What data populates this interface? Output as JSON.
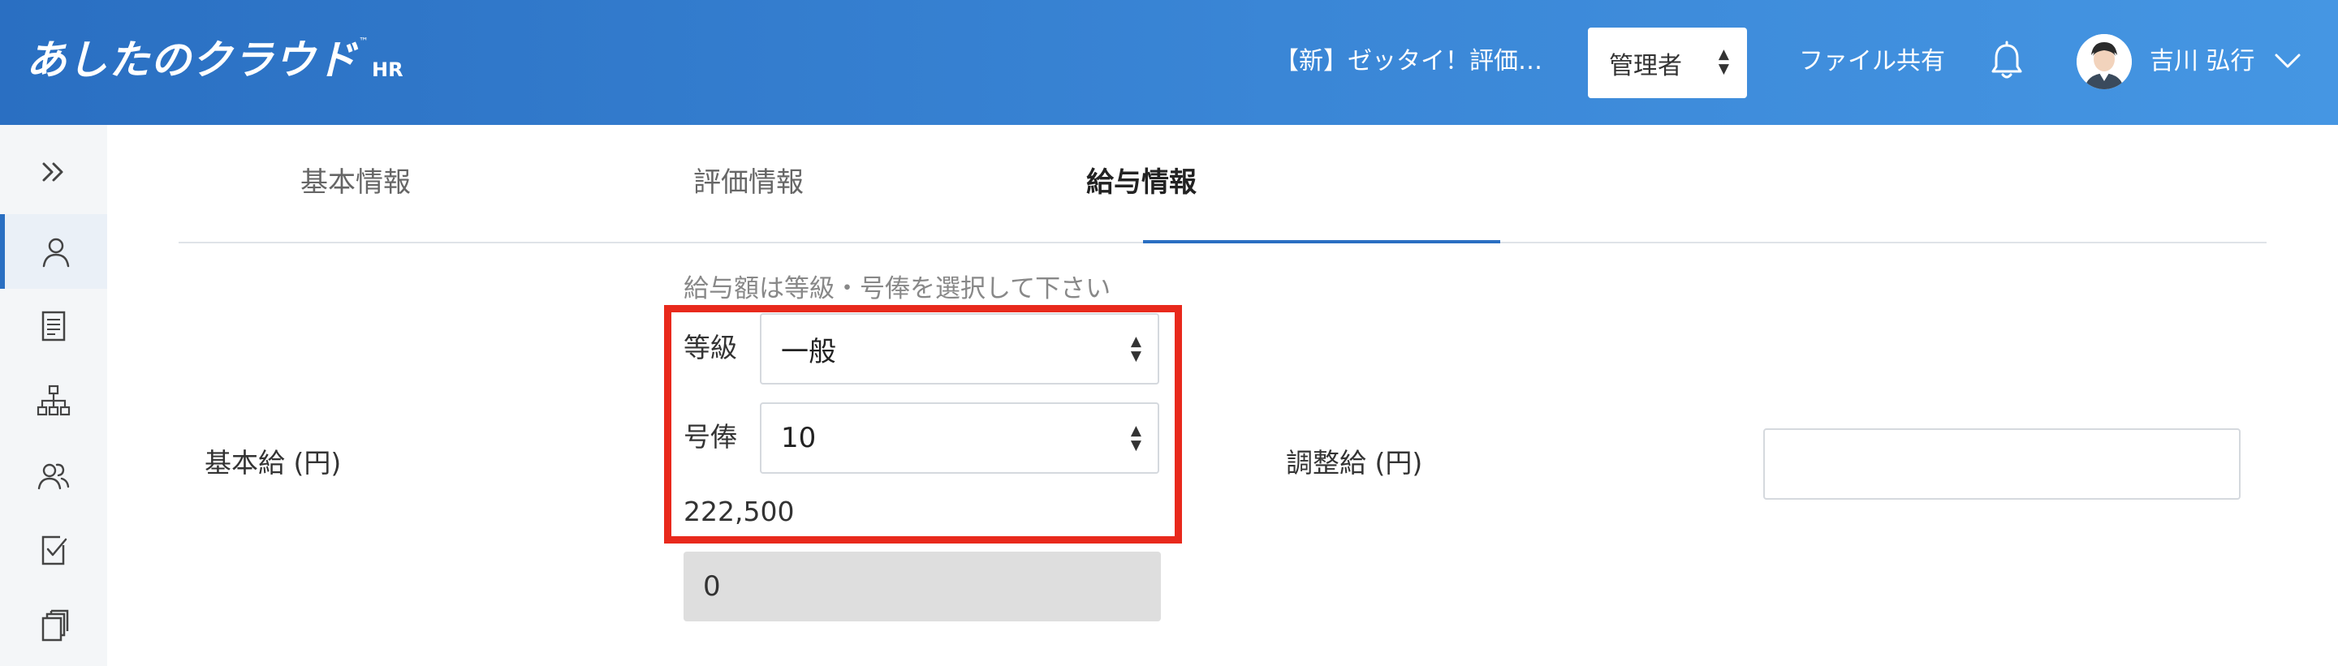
{
  "header": {
    "logo_text": "あしたのクラウド",
    "logo_tm": "™",
    "logo_suffix": "HR",
    "evaluation_title": "【新】ゼッタイ！評価…",
    "role_select": {
      "value": "管理者",
      "icon": "updown-caret-icon"
    },
    "file_share_label": "ファイル共有",
    "notification_icon": "bell-icon",
    "user_name": "吉川 弘行",
    "user_menu_icon": "chevron-down-icon",
    "brand_color": "#2a6fc2"
  },
  "sidebar": {
    "items": [
      {
        "icon": "double-chevron-right-icon",
        "active": false
      },
      {
        "icon": "person-icon",
        "active": true
      },
      {
        "icon": "document-icon",
        "active": false
      },
      {
        "icon": "org-chart-icon",
        "active": false
      },
      {
        "icon": "people-icon",
        "active": false
      },
      {
        "icon": "checklist-icon",
        "active": false
      },
      {
        "icon": "copy-icon",
        "active": false
      }
    ]
  },
  "tabs": [
    {
      "label": "基本情報",
      "active": false
    },
    {
      "label": "評価情報",
      "active": false
    },
    {
      "label": "給与情報",
      "active": true
    }
  ],
  "salary": {
    "base_label": "基本給 (円)",
    "hint": "給与額は等級・号俸を選択して下さい",
    "grade_label": "等級",
    "grade_value": "一般",
    "step_label": "号俸",
    "step_value": "10",
    "amount": "222,500",
    "readonly_value": "0",
    "adjustment_label": "調整給 (円)",
    "adjustment_value": "",
    "highlight_color": "#e8291c"
  }
}
